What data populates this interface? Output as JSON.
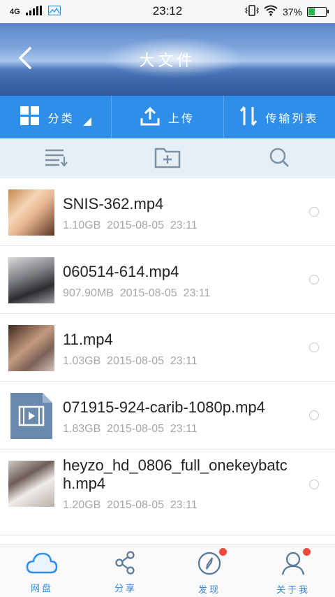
{
  "status_bar": {
    "network": "4G",
    "time": "23:12",
    "battery_text": "37%",
    "battery_level": 0.37,
    "icons": [
      "signal-icon",
      "gallery-icon",
      "vibrate-icon",
      "wifi-icon",
      "battery-icon"
    ]
  },
  "header": {
    "title": "大文件",
    "back_icon": "chevron-left-icon"
  },
  "actions": {
    "category_label": "分类",
    "upload_label": "上传",
    "transfer_label": "传输列表"
  },
  "toolbar": {
    "icons": [
      "sort-list-icon",
      "new-folder-icon",
      "search-icon"
    ]
  },
  "files": [
    {
      "name": "SNIS-362.mp4",
      "size": "1.10GB",
      "date": "2015-08-05  23:11"
    },
    {
      "name": "060514-614.mp4",
      "size": "907.90MB",
      "date": "2015-08-05  23:11"
    },
    {
      "name": "11.mp4",
      "size": "1.03GB",
      "date": "2015-08-05  23:11"
    },
    {
      "name": "071915-924-carib-1080p.mp4",
      "size": "1.83GB",
      "date": "2015-08-05  23:11"
    },
    {
      "name": "heyzo_hd_0806_full_onekeybatch.mp4",
      "size": "1.20GB",
      "date": "2015-08-05  23:11"
    }
  ],
  "nav": {
    "items": [
      {
        "label": "网盘",
        "icon": "cloud-icon",
        "active": true
      },
      {
        "label": "分享",
        "icon": "share-icon",
        "active": false
      },
      {
        "label": "发现",
        "icon": "compass-icon",
        "active": false,
        "badge": true
      },
      {
        "label": "关于我",
        "icon": "user-icon",
        "active": false,
        "badge": true
      }
    ]
  },
  "colors": {
    "primary": "#2f8ee8",
    "badge": "#ec4a3f",
    "meta_text": "#a6a6a6"
  }
}
